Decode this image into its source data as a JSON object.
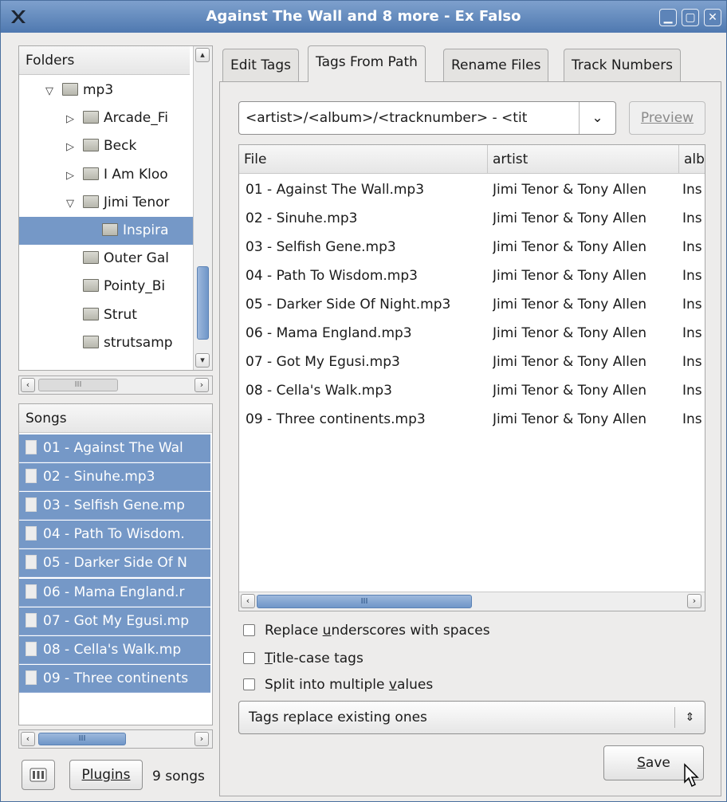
{
  "window": {
    "title": "Against The Wall and 8 more - Ex Falso",
    "buttons": [
      "minimize",
      "maximize",
      "close"
    ]
  },
  "folders": {
    "header": "Folders",
    "items": [
      {
        "label": "mp3",
        "expander": "▽",
        "level": 0,
        "selected": false
      },
      {
        "label": "Arcade_Fi",
        "expander": "▷",
        "level": 1,
        "selected": false
      },
      {
        "label": "Beck",
        "expander": "▷",
        "level": 1,
        "selected": false
      },
      {
        "label": "I Am Kloo",
        "expander": "▷",
        "level": 1,
        "selected": false
      },
      {
        "label": "Jimi Tenor",
        "expander": "▽",
        "level": 1,
        "selected": false
      },
      {
        "label": "Inspira",
        "expander": "",
        "level": 2,
        "selected": true
      },
      {
        "label": "Outer Gal",
        "expander": "",
        "level": 1,
        "selected": false
      },
      {
        "label": "Pointy_Bi",
        "expander": "",
        "level": 1,
        "selected": false
      },
      {
        "label": "Strut",
        "expander": "",
        "level": 1,
        "selected": false
      },
      {
        "label": "strutsamp",
        "expander": "",
        "level": 1,
        "selected": false
      }
    ]
  },
  "songs": {
    "header": "Songs",
    "items": [
      "01 - Against The Wal",
      "02 - Sinuhe.mp3",
      "03 - Selfish Gene.mp",
      "04 - Path To Wisdom.",
      "05 - Darker Side Of N",
      "06 - Mama England.r",
      "07 - Got My Egusi.mp",
      "08 - Cella's Walk.mp",
      "09 - Three continents"
    ]
  },
  "bottom_bar": {
    "prefs_icon": "preferences-icon",
    "plugins_label": "Plugins",
    "song_count": "9 songs"
  },
  "tabs": [
    {
      "label": "Edit Tags",
      "active": false
    },
    {
      "label": "Tags From Path",
      "active": true
    },
    {
      "label": "Rename Files",
      "active": false
    },
    {
      "label": "Track Numbers",
      "active": false
    }
  ],
  "pattern": {
    "value": "<artist>/<album>/<tracknumber> - <tit",
    "preview_label": "Preview"
  },
  "table": {
    "columns": [
      "File",
      "artist",
      "alb"
    ],
    "rows": [
      {
        "file": "01 - Against The Wall.mp3",
        "artist": "Jimi Tenor & Tony Allen",
        "album": "Ins"
      },
      {
        "file": "02 - Sinuhe.mp3",
        "artist": "Jimi Tenor & Tony Allen",
        "album": "Ins"
      },
      {
        "file": "03 - Selfish Gene.mp3",
        "artist": "Jimi Tenor & Tony Allen",
        "album": "Ins"
      },
      {
        "file": "04 - Path To Wisdom.mp3",
        "artist": "Jimi Tenor & Tony Allen",
        "album": "Ins"
      },
      {
        "file": "05 - Darker Side Of Night.mp3",
        "artist": "Jimi Tenor & Tony Allen",
        "album": "Ins"
      },
      {
        "file": "06 - Mama England.mp3",
        "artist": "Jimi Tenor & Tony Allen",
        "album": "Ins"
      },
      {
        "file": "07 - Got My Egusi.mp3",
        "artist": "Jimi Tenor & Tony Allen",
        "album": "Ins"
      },
      {
        "file": "08 - Cella's Walk.mp3",
        "artist": "Jimi Tenor & Tony Allen",
        "album": "Ins"
      },
      {
        "file": "09 - Three continents.mp3",
        "artist": "Jimi Tenor & Tony Allen",
        "album": "Ins"
      }
    ]
  },
  "options": {
    "replace_underscores": {
      "pre": "Replace ",
      "mnemonic": "u",
      "post": "nderscores with spaces",
      "checked": false
    },
    "title_case": {
      "pre": "",
      "mnemonic": "T",
      "post": "itle-case tags",
      "checked": false
    },
    "split_values": {
      "pre": "Split into multiple ",
      "mnemonic": "v",
      "post": "alues",
      "checked": false
    }
  },
  "mode_select": {
    "value": "Tags replace existing ones"
  },
  "save_button": {
    "mnemonic": "S",
    "rest": "ave"
  },
  "colors": {
    "selection": "#7598c7",
    "titlebar": "#5b83b8"
  }
}
